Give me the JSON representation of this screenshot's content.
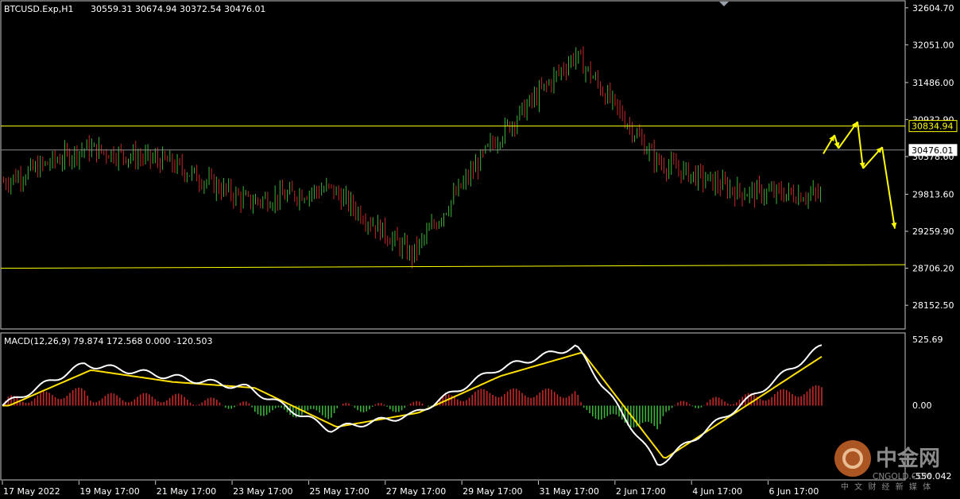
{
  "header": {
    "symbol": "BTCUSD.Exp,H1",
    "ohlc": "30559.31 30674.94 30372.54 30476.01"
  },
  "macd_header": "MACD(12,26,9) 79.874 172.568 0.000 -120.503",
  "colors": {
    "background": "#000000",
    "bull": "#3cb43c",
    "bear": "#c82828",
    "macd_line": "#ffffff",
    "signal_line": "#ffe000",
    "hline": "#ffff00",
    "arrow": "#ffff00",
    "grid_frame": "#c8c8c8"
  },
  "price_axis": [
    "32604.70",
    "32051.00",
    "31486.00",
    "30932.90",
    "30378.60",
    "29813.60",
    "29259.90",
    "28706.20",
    "28152.50"
  ],
  "price_tags": [
    {
      "text": "30834.94",
      "value": 30834.94,
      "style": "yellow"
    },
    {
      "text": "30476.01",
      "value": 30476.01,
      "style": "white"
    }
  ],
  "macd_axis": [
    "525.69",
    "0.00",
    "-550.042"
  ],
  "time_axis": [
    "17 May 2022",
    "19 May 17:00",
    "21 May 17:00",
    "23 May 17:00",
    "25 May 17:00",
    "27 May 17:00",
    "29 May 17:00",
    "31 May 17:00",
    "2 Jun 17:00",
    "4 Jun 17:00",
    "6 Jun 17:00"
  ],
  "watermark": {
    "main": "中金网",
    "sub": "中 文 财 经 新 媒 体",
    "domain": "CNGOLD.COM"
  },
  "chart_data": {
    "type": "line",
    "title": "BTCUSD.Exp,H1",
    "series": [
      {
        "name": "BTCUSD.Exp",
        "x": [
          "17 May 2022",
          "19 May 17:00",
          "21 May 17:00",
          "23 May 17:00",
          "25 May 17:00",
          "27 May 17:00",
          "29 May 17:00",
          "31 May 17:00",
          "2 Jun 17:00",
          "4 Jun 17:00",
          "6 Jun 17:00"
        ],
        "values": [
          30000,
          30500,
          30300,
          29700,
          29900,
          28900,
          30600,
          31900,
          30300,
          29850,
          29800
        ]
      }
    ],
    "price_range": [
      28000,
      32650
    ],
    "macd": {
      "range": [
        -560,
        560
      ],
      "x": [
        "17 May 2022",
        "19 May 17:00",
        "21 May 17:00",
        "23 May 17:00",
        "25 May 17:00",
        "27 May 17:00",
        "29 May 17:00",
        "31 May 17:00",
        "2 Jun 17:00",
        "4 Jun 17:00",
        "6 Jun 17:00"
      ],
      "macd_values": [
        0,
        350,
        250,
        150,
        -200,
        -80,
        300,
        500,
        -500,
        0,
        500
      ],
      "signal_values": [
        0,
        300,
        200,
        150,
        -180,
        -60,
        250,
        450,
        -450,
        0,
        450
      ]
    },
    "horizontal_lines": [
      {
        "value": 30834.94
      },
      {
        "value": 28706.2,
        "end_value": 28760
      }
    ],
    "forecast_path": [
      30420,
      30700,
      30500,
      30900,
      30200,
      30520,
      29300
    ]
  }
}
